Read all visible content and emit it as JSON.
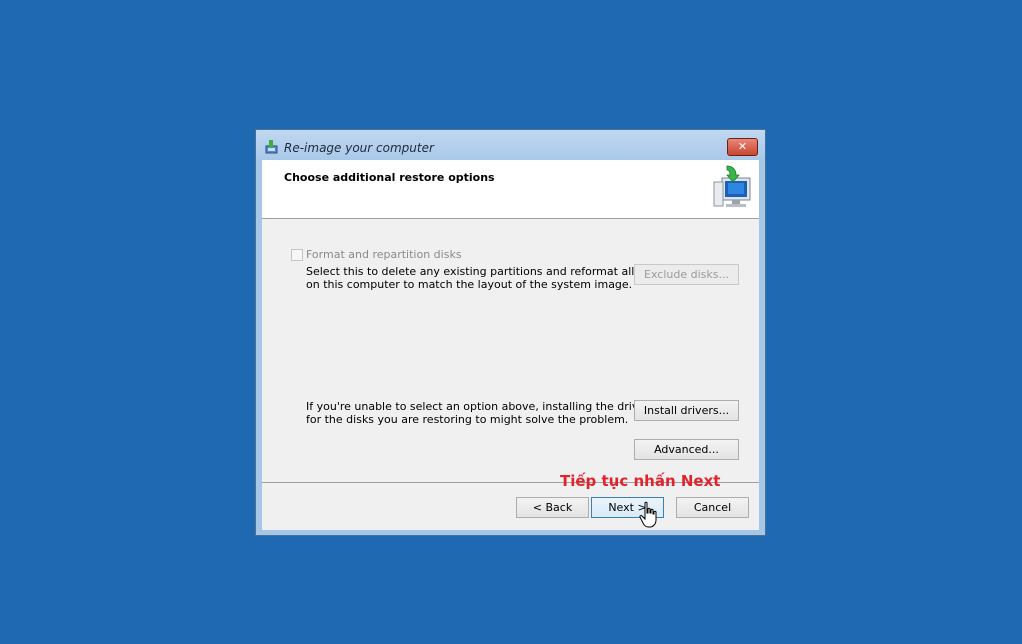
{
  "window": {
    "title": "Re-image your computer",
    "close_glyph": "✕"
  },
  "header": {
    "title": "Choose additional restore options",
    "icon": "monitor-restore-icon"
  },
  "options": {
    "format_checkbox_label": "Format and repartition disks",
    "format_checked": false,
    "format_description_line1": "Select this to delete any existing partitions and reformat all disks",
    "format_description_line2": "on this computer to match the layout of the system image.",
    "exclude_disks_label": "Exclude disks...",
    "drivers_description_line1": "If you're unable to select an option above, installing the drivers",
    "drivers_description_line2": "for the disks you are restoring to might solve the problem.",
    "install_drivers_label": "Install drivers...",
    "advanced_label": "Advanced..."
  },
  "footer": {
    "back_label": "< Back",
    "next_label": "Next >",
    "cancel_label": "Cancel"
  },
  "annotation": {
    "text": "Tiếp tục nhấn Next",
    "color": "#e0242e"
  },
  "colors": {
    "desktop": "#1f69b3",
    "window_frame": "#a6c6e8"
  }
}
